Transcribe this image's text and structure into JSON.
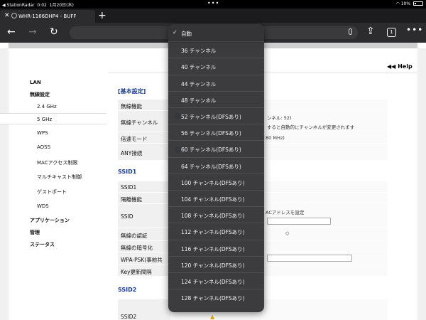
{
  "status_bar": {
    "back_app": "◀ StationRadar",
    "time": "0:02",
    "date": "1月20日(木)",
    "battery": "10%"
  },
  "tab": {
    "title": "WHR-1166DHP4 - BUFF"
  },
  "page": {
    "help": "◀◀ Help",
    "nav": {
      "lan": "LAN",
      "wireless": "無線設定",
      "ghz24": "2.4 GHz",
      "ghz5": "5 GHz",
      "wps": "WPS",
      "aoss": "AOSS",
      "mac": "MACアクセス制限",
      "multicast": "マルチキャスト制御",
      "guest": "ゲストポート",
      "wds": "WDS",
      "apps": "アプリケーション",
      "admin": "管理",
      "status": "ステータス"
    },
    "basic": {
      "title": "[基本設定]",
      "wireless_func": "無線機能",
      "wireless_channel": "無線チャンネル",
      "channel_frag1": "ンネル: 52)",
      "channel_frag2": "すると自動的にチャンネルが変更されます",
      "bandwidth": "倍速モード",
      "bandwidth_frag": "80 MHz)",
      "any": "ANY接続"
    },
    "ssid1": {
      "title": "SSID1",
      "ssid1": "SSID1",
      "isolation": "隔離機能",
      "ssid": "SSID",
      "ssid_frag": "ACアドレスを設定",
      "auth": "無線の認証",
      "encrypt": "無線の暗号化",
      "wpa": "WPA-PSK(事前共",
      "key_interval": "Key更新間隔"
    },
    "ssid2": {
      "title": "SSID2",
      "ssid2": "SSID2"
    }
  },
  "dropdown": {
    "items": [
      {
        "label": "自動",
        "selected": true
      },
      {
        "label": "36 チャンネル"
      },
      {
        "label": "40 チャンネル"
      },
      {
        "label": "44 チャンネル"
      },
      {
        "label": "48 チャンネル"
      },
      {
        "label": "52 チャンネル(DFSあり)"
      },
      {
        "label": "56 チャンネル(DFSあり)"
      },
      {
        "label": "60 チャンネル(DFSあり)"
      },
      {
        "label": "64 チャンネル(DFSあり)"
      },
      {
        "label": "100 チャンネル(DFSあり)"
      },
      {
        "label": "104 チャンネル(DFSあり)"
      },
      {
        "label": "108 チャンネル(DFSあり)"
      },
      {
        "label": "112 チャンネル(DFSあり)"
      },
      {
        "label": "116 チャンネル(DFSあり)"
      },
      {
        "label": "120 チャンネル(DFSあり)"
      },
      {
        "label": "124 チャンネル(DFSあり)"
      },
      {
        "label": "128 チャンネル(DFSあり)"
      }
    ],
    "check_mark": "✓"
  }
}
